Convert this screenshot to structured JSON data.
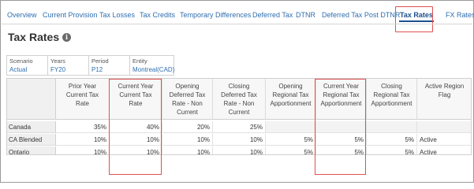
{
  "tabs": [
    {
      "label": "Overview"
    },
    {
      "label": "Current Provision"
    },
    {
      "label": "Tax Losses"
    },
    {
      "label": "Tax Credits"
    },
    {
      "label": "Temporary Differences"
    },
    {
      "label": "Deferred Tax"
    },
    {
      "label": "DTNR"
    },
    {
      "label": "Deferred Tax Post DTNR"
    },
    {
      "label": "Tax Rates",
      "active": true
    },
    {
      "label": "FX Rates"
    }
  ],
  "page": {
    "title": "Tax Rates",
    "info_icon": "info-icon"
  },
  "pov": [
    {
      "label": "Scenario",
      "value": "Actual"
    },
    {
      "label": "Years",
      "value": "FY20"
    },
    {
      "label": "Period",
      "value": "P12"
    },
    {
      "label": "Entity",
      "value": "Montreal(CAD)"
    }
  ],
  "grid": {
    "columns": [
      {
        "lines": [
          "Prior Year",
          "Current Tax",
          "Rate"
        ]
      },
      {
        "lines": [
          "Current Year",
          "Current Tax",
          "Rate"
        ]
      },
      {
        "lines": [
          "Opening",
          "Deferred Tax",
          "Rate - Non",
          "Current"
        ]
      },
      {
        "lines": [
          "Closing",
          "Deferred Tax",
          "Rate - Non",
          "Current"
        ]
      },
      {
        "lines": [
          "Opening",
          "Regional Tax",
          "Apportionment"
        ]
      },
      {
        "lines": [
          "Current Year",
          "Regional Tax",
          "Apportionment"
        ]
      },
      {
        "lines": [
          "Closing",
          "Regional Tax",
          "Apportionment"
        ]
      },
      {
        "lines": [
          "Active Region",
          "Flag"
        ]
      }
    ],
    "rows": [
      {
        "label": "Canada",
        "cells": [
          "35%",
          "40%",
          "20%",
          "25%",
          "",
          "",
          "",
          ""
        ]
      },
      {
        "label": "CA Blended",
        "cells": [
          "10%",
          "10%",
          "10%",
          "10%",
          "5%",
          "5%",
          "5%",
          "Active"
        ]
      },
      {
        "label": "Ontario",
        "cells": [
          "10%",
          "10%",
          "10%",
          "10%",
          "5%",
          "5%",
          "5%",
          "Active"
        ]
      }
    ]
  },
  "colors": {
    "link": "#2f6fb0",
    "highlight": "#e05050"
  }
}
